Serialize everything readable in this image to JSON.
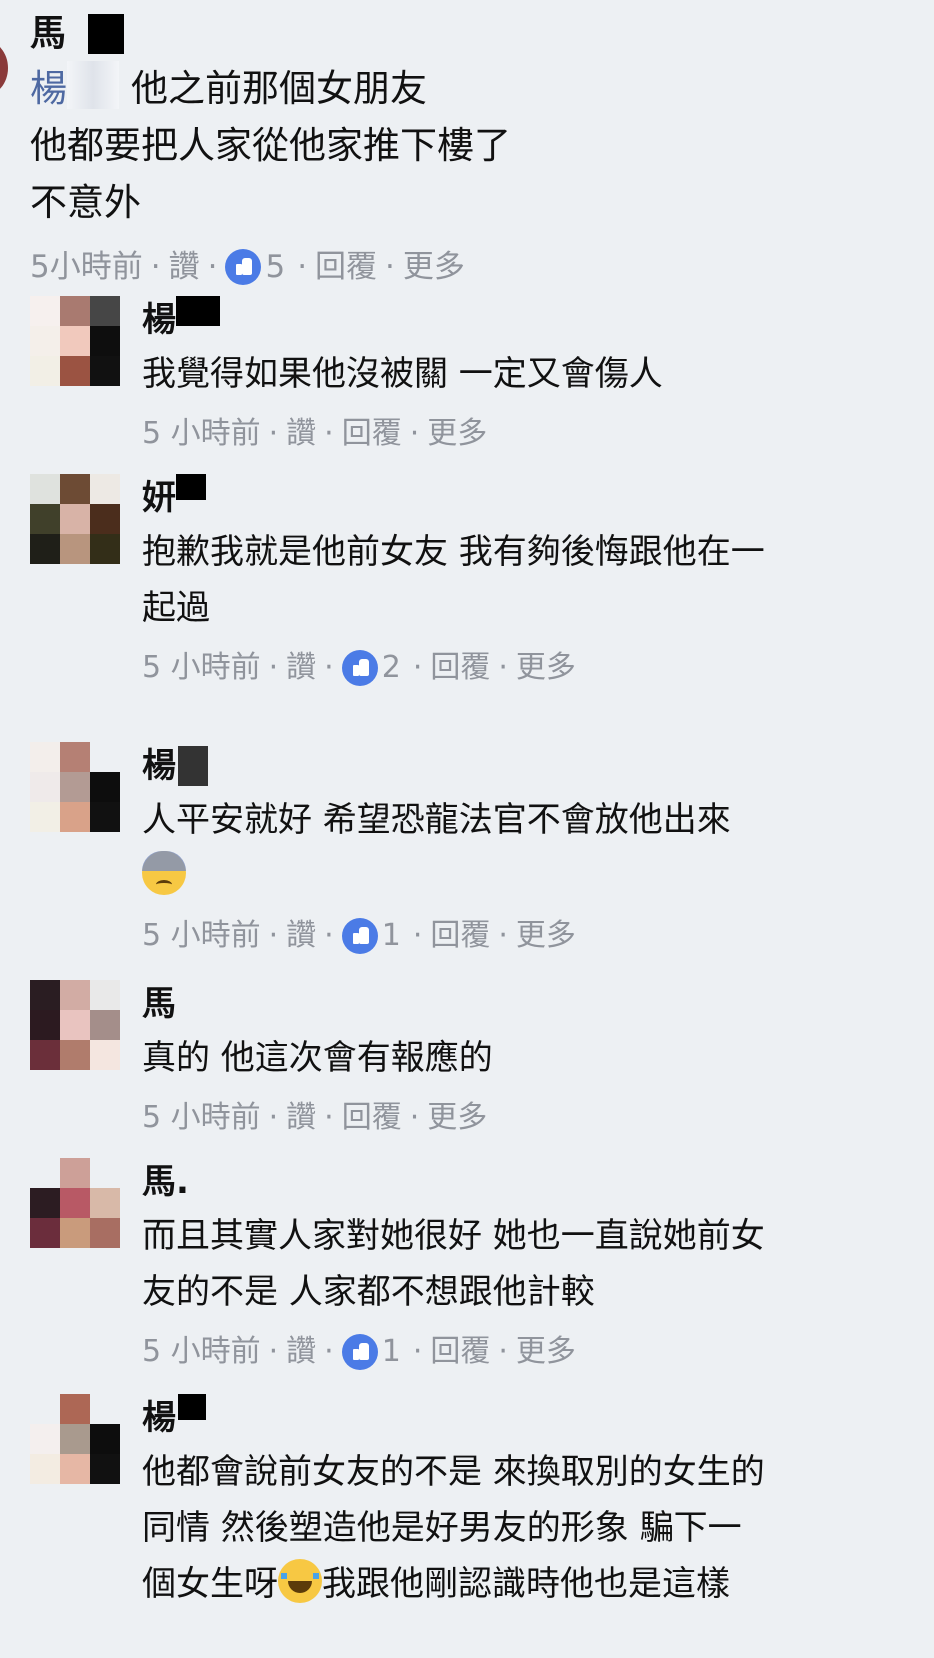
{
  "top_comment": {
    "author": "馬",
    "mention": "楊",
    "lines": [
      "他之前那個女朋友",
      "他都要把人家從他家推下樓了",
      "不意外"
    ],
    "time": "5小時前",
    "like_label": "讚",
    "likes": "5",
    "reply_label": "回覆",
    "more_label": "更多"
  },
  "replies": [
    {
      "author": "楊",
      "lines": [
        "我覺得如果他沒被關 一定又會傷人"
      ],
      "time": "5 小時前",
      "like_label": "讚",
      "reply_label": "回覆",
      "more_label": "更多"
    },
    {
      "author": "妍",
      "lines": [
        "抱歉我就是他前女友 我有夠後悔跟他在一",
        "起過"
      ],
      "time": "5 小時前",
      "like_label": "讚",
      "likes": "2",
      "reply_label": "回覆",
      "more_label": "更多"
    },
    {
      "author": "楊",
      "lines": [
        "人平安就好 希望恐龍法官不會放他出來"
      ],
      "time": "5 小時前",
      "like_label": "讚",
      "likes": "1",
      "reply_label": "回覆",
      "more_label": "更多",
      "emoji": "sad-emoji"
    },
    {
      "author": "馬",
      "lines": [
        "真的 他這次會有報應的"
      ],
      "time": "5 小時前",
      "like_label": "讚",
      "reply_label": "回覆",
      "more_label": "更多"
    },
    {
      "author": "馬.",
      "lines": [
        "而且其實人家對她很好 她也一直說她前女",
        "友的不是 人家都不想跟他計較"
      ],
      "time": "5 小時前",
      "like_label": "讚",
      "likes": "1",
      "reply_label": "回覆",
      "more_label": "更多"
    },
    {
      "author": "楊",
      "lines": [
        "他都會說前女友的不是 來換取別的女生的",
        "同情 然後塑造他是好男友的形象 騙下一"
      ],
      "last_line_a": "個女生呀",
      "last_line_b": "我跟他剛認識時他也是這樣",
      "emoji": "laughing-tears-emoji"
    }
  ],
  "colors": {
    "background": "#edf0f3",
    "meta_text": "#90949c",
    "mention": "#4e69a2",
    "like_badge": "#4b7be6"
  }
}
